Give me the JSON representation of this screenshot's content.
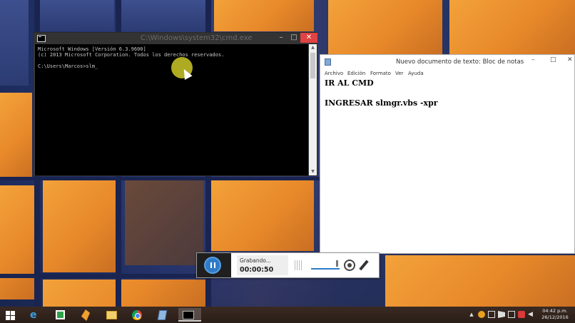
{
  "cmd_window": {
    "title": "C:\\Windows\\system32\\cmd.exe",
    "controls": {
      "minimize": "–",
      "maximize": "□",
      "close": "✕"
    },
    "lines": [
      "Microsoft Windows [Versión 6.3.9600]",
      "(c) 2013 Microsoft Corporation. Todos los derechos reservados.",
      "",
      "C:\\Users\\Marcos>slm_"
    ]
  },
  "notepad": {
    "title": "Nuevo documento de texto: Bloc de notas",
    "controls": {
      "minimize": "–",
      "maximize": "□",
      "close": "✕"
    },
    "menu": [
      "Archivo",
      "Edición",
      "Formato",
      "Ver",
      "Ayuda"
    ],
    "lines": [
      "IR AL CMD",
      "",
      "INGRESAR slmgr.vbs -xpr"
    ]
  },
  "recorder": {
    "status_label": "Grabando...",
    "elapsed_time": "00:00:50"
  },
  "taskbar": {
    "apps": [
      "start-icon",
      "internet-explorer-icon",
      "store-icon",
      "app-icon",
      "file-explorer-icon",
      "chrome-icon",
      "notepad-icon",
      "cmd-icon"
    ],
    "tray_up_arrow": "▲",
    "clock_time": "04:42 p.m.",
    "clock_date": "26/12/2016"
  },
  "colors": {
    "cmd_close": "#e04343",
    "recorder_accent": "#2e7cc9",
    "cursor_highlight": "#cdc828"
  }
}
